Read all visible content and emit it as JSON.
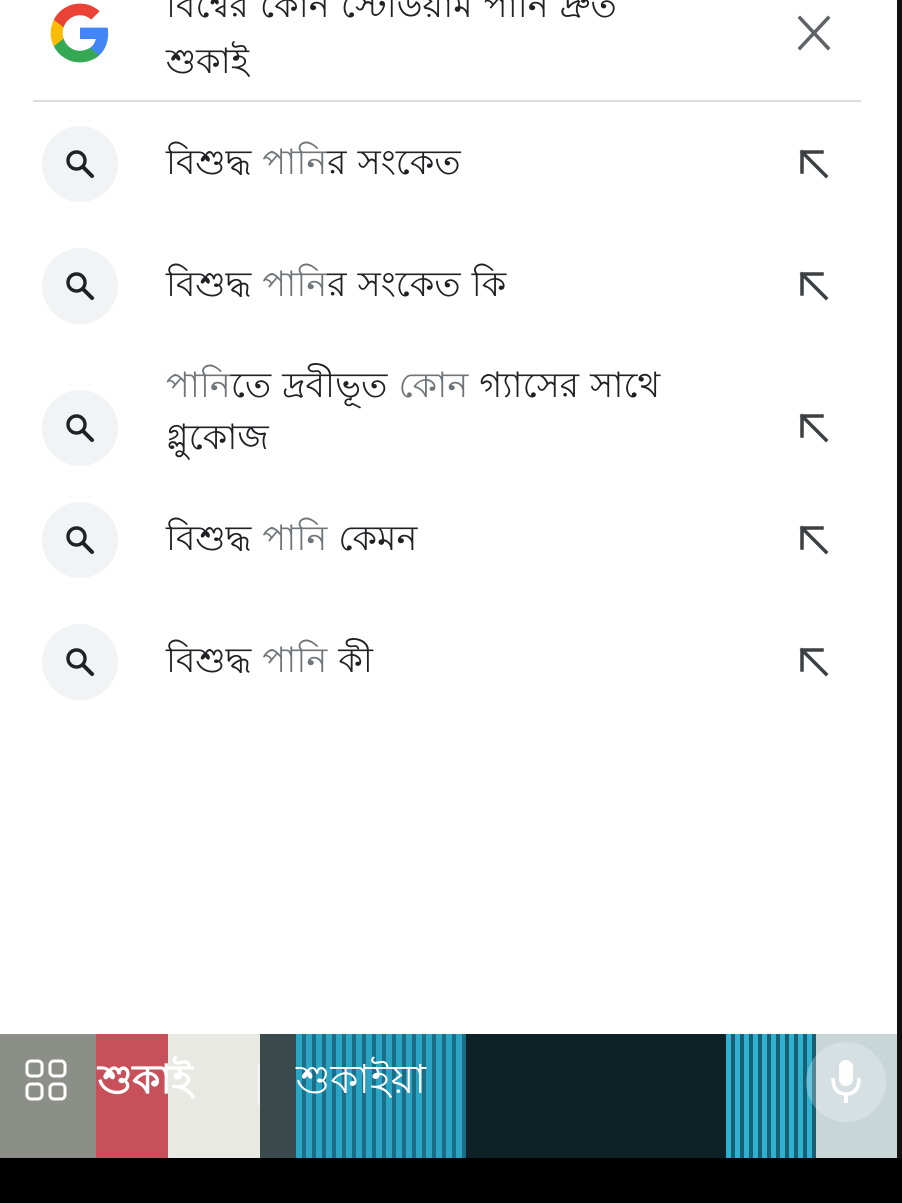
{
  "search": {
    "query_line1": "বিশ্বের কোন স্টেডিয়াম পানি দ্রুত",
    "query_line2": "শুকাই"
  },
  "suggestions": [
    {
      "segments": [
        {
          "text": "বিশুদ্ধ ",
          "hl": false
        },
        {
          "text": "পানি",
          "hl": true
        },
        {
          "text": "র সংকেত",
          "hl": false
        }
      ]
    },
    {
      "segments": [
        {
          "text": "বিশুদ্ধ ",
          "hl": false
        },
        {
          "text": "পানি",
          "hl": true
        },
        {
          "text": "র সংকেত কি",
          "hl": false
        }
      ]
    },
    {
      "segments": [
        {
          "text": "পানি",
          "hl": true
        },
        {
          "text": "তে দ্রবীভূত ",
          "hl": false
        },
        {
          "text": "কোন",
          "hl": true
        },
        {
          "text": " গ্যাসের সাথে গ্লুকোজ",
          "hl": false
        }
      ]
    },
    {
      "segments": [
        {
          "text": "বিশুদ্ধ ",
          "hl": false
        },
        {
          "text": "পানি",
          "hl": true
        },
        {
          "text": " কেমন",
          "hl": false
        }
      ]
    },
    {
      "segments": [
        {
          "text": "বিশুদ্ধ ",
          "hl": false
        },
        {
          "text": "পানি",
          "hl": true
        },
        {
          "text": " কী",
          "hl": false
        }
      ]
    }
  ],
  "keyboard": {
    "suggestion_1": "শুকাই",
    "suggestion_2": "শুকাইয়া"
  },
  "icons": {
    "logo": "google-g-icon",
    "clear": "close-icon",
    "suggestion": "search-icon",
    "fill_query": "arrow-up-left-icon",
    "apps": "apps-grid-icon",
    "voice": "mic-icon"
  },
  "colors": {
    "text": "#202124",
    "highlight": "#70757a",
    "icon_bg": "#f1f3f4"
  }
}
